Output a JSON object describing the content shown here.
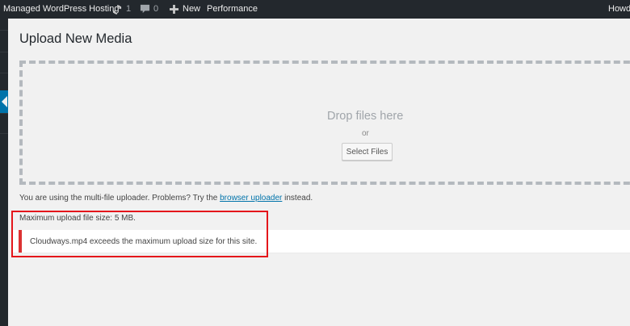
{
  "admin_bar": {
    "site_name": "Managed WordPress Hosting",
    "updates_count": "1",
    "comments_count": "0",
    "new_label": "New",
    "performance_label": "Performance",
    "howdy_label": "Howdy"
  },
  "page": {
    "title": "Upload New Media"
  },
  "dropzone": {
    "instructions": "Drop files here",
    "or_label": "or",
    "select_files_label": "Select Files"
  },
  "uploader_info": {
    "prefix": "You are using the multi-file uploader. Problems? Try the ",
    "link_label": "browser uploader",
    "suffix": " instead."
  },
  "max_upload": {
    "text": "Maximum upload file size: 5 MB."
  },
  "error": {
    "message": "Cloudways.mp4 exceeds the maximum upload size for this site.",
    "accent_color": "#dc3232"
  },
  "annotation": {
    "highlight_color": "#e4161b"
  },
  "theme": {
    "admin_bar_bg": "#23282d",
    "link_color": "#0073aa",
    "page_bg": "#f1f1f1"
  }
}
